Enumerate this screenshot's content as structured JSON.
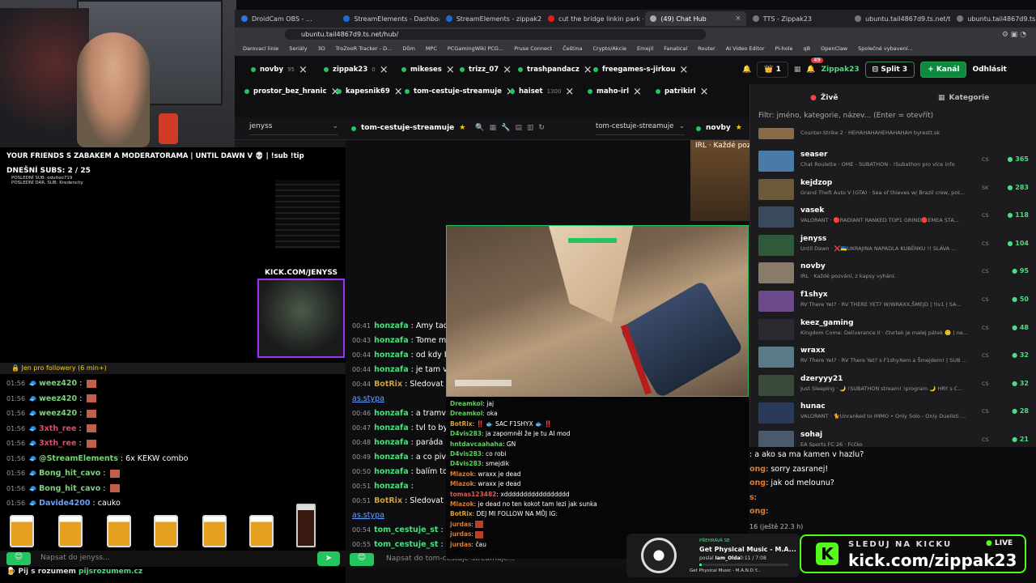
{
  "tabs": [
    {
      "label": "DroidCam OBS - ..."
    },
    {
      "label": "StreamElements - Dashboard"
    },
    {
      "label": "StreamElements - zippak23"
    },
    {
      "label": "cut the bridge linkin park - YouT..."
    },
    {
      "label": "(49) Chat Hub",
      "active": true
    },
    {
      "label": "TTS - Zippak23"
    },
    {
      "label": "ubuntu.tail4867d9.ts.net/tts/api/..."
    },
    {
      "label": "ubuntu.tail4867d9.ts.net/tts/api/..."
    }
  ],
  "address": "ubuntu.tail4867d9.ts.net/hub/",
  "bookmarks": [
    "Darovací linie",
    "Seriály",
    "3D",
    "TroZooR Tracker - D...",
    "Dům",
    "MPC",
    "PCGamingWiki PCG...",
    "Pruse Connect",
    "Čeština",
    "Crypto/Akcie",
    "Ernejil",
    "Fanatical",
    "Router",
    "AI Video Editor",
    "Pi-hole",
    "qB",
    "OpenClaw",
    "Společné vybavení..."
  ],
  "stream_tabs": [
    {
      "name": "novby",
      "count": "95"
    },
    {
      "name": "zippak23",
      "count": "0"
    },
    {
      "name": "mikeses",
      "count": ""
    },
    {
      "name": "trizz_07",
      "count": ""
    },
    {
      "name": "trashpandacz",
      "count": ""
    },
    {
      "name": "freegames-s-jirkou",
      "count": ""
    },
    {
      "name": "prostor_bez_hranic",
      "count": ""
    },
    {
      "name": "kapesnik69",
      "count": ""
    },
    {
      "name": "tom-cestuje-streamuje",
      "count": ""
    },
    {
      "name": "haiset",
      "count": "1300"
    },
    {
      "name": "maho-irl",
      "count": ""
    },
    {
      "name": "patrikirl",
      "count": ""
    }
  ],
  "top": {
    "coins": "1",
    "bell_badge": "49",
    "user": "Zippak23",
    "split": "Split 3",
    "add_channel": "+ Kanál",
    "logout": "Odhlásit"
  },
  "side": {
    "tab_live": "Živě",
    "tab_categories": "Kategorie",
    "filter_placeholder": "Filtr: jméno, kategorie, název... (Enter = otevřít)",
    "first_desc": "Counter-Strike 2 · HEHAHAHAHEHAHAHAH byrestt.sk",
    "channels": [
      {
        "name": "seaser",
        "desc": "Chat Roulette · OME - SUBATHON - !Subathon pro více info",
        "lang": "CS",
        "viewers": "365",
        "color": "#4a7ba8"
      },
      {
        "name": "kejdzop",
        "desc": "Grand Theft Auto V (GTA) · Sea of thieves w/ Brazil crew, pot...",
        "lang": "SK",
        "viewers": "283",
        "color": "#6b5a3a"
      },
      {
        "name": "vasek",
        "desc": "VALORANT · 🔴RADIANT RANKED TOP1 GRIND🔴EMEA STA...",
        "lang": "CS",
        "viewers": "118",
        "color": "#3a4a5c"
      },
      {
        "name": "jenyss",
        "desc": "Until Dawn · ❌🇺🇦UKRAJINA NAPADLA KUBĚNKU !! SLÁVA ...",
        "lang": "CS",
        "viewers": "104",
        "color": "#2e5a3a"
      },
      {
        "name": "novby",
        "desc": "IRL · Každé pozvání, z kapsy vyhání.",
        "lang": "CS",
        "viewers": "95",
        "color": "#8a7a6a"
      },
      {
        "name": "f1shyx",
        "desc": "RV There Yet? · RV THERE YET? W/WRAXX,ŠMEJD | !tv1 | SA...",
        "lang": "CS",
        "viewers": "50",
        "color": "#6a4a8a"
      },
      {
        "name": "keez_gaming",
        "desc": "Kingdom Come: Deliverance II · čtvrtek je malej pátek 🙂 | ne...",
        "lang": "CS",
        "viewers": "48",
        "color": "#2a2a30"
      },
      {
        "name": "wraxx",
        "desc": "RV There Yet? · RV There Yet? s F1shyXem a Šmejdem! | SUB ...",
        "lang": "CS",
        "viewers": "32",
        "color": "#5a7a8a"
      },
      {
        "name": "dzeryyy21",
        "desc": "Just Sleeping · 🌙 !SUBATHON stream! !program 🌙 HRY s C...",
        "lang": "CS",
        "viewers": "32",
        "color": "#3a4a3a"
      },
      {
        "name": "hunac",
        "desc": "VALORANT · 🐈Unranked to IMMO • Only Solo - Only Duelisti ...",
        "lang": "CS",
        "viewers": "28",
        "color": "#2a3a5a"
      },
      {
        "name": "sohaj",
        "desc": "EA Sports FC 26 · Fcčko",
        "lang": "CS",
        "viewers": "21",
        "color": "#4a5a6a"
      }
    ]
  },
  "left": {
    "ticker": "YOUR FRIENDS S ZABAKEM A MODERATORAMA | UNTIL DAWN V 💀 | !sub !tip",
    "subs": "DNEŠNÍ SUBS: 2 / 25",
    "last_sub": "POSLEDNÍ SUB: odviteo719",
    "last_dar": "POSLEDNÍ DAR. SUB: Kredencity",
    "kick_label": "KICK.COM/JENYSS",
    "followers_only": "Jen pro followery (6 min+)",
    "chat": [
      {
        "t": "01:56",
        "user": "weez420",
        "msg": "",
        "color": "#7cd17c"
      },
      {
        "t": "01:56",
        "user": "weez420",
        "msg": "",
        "color": "#7cd17c"
      },
      {
        "t": "01:56",
        "user": "weez420",
        "msg": "",
        "color": "#7cd17c"
      },
      {
        "t": "01:56",
        "user": "3xth_ree",
        "msg": "",
        "color": "#e04a6a"
      },
      {
        "t": "01:56",
        "user": "3xth_ree",
        "msg": "",
        "color": "#e04a6a"
      },
      {
        "t": "01:56",
        "user": "@StreamElements",
        "msg": "6x KEKW combo",
        "color": "#7cd17c"
      },
      {
        "t": "01:56",
        "user": "Bong_hit_cavo",
        "msg": "",
        "color": "#7cd17c"
      },
      {
        "t": "01:56",
        "user": "Bong_hit_cavo",
        "msg": "",
        "color": "#7cd17c"
      },
      {
        "t": "01:56",
        "user": "Davide4200",
        "msg": "cauko",
        "color": "#6aa0ff"
      }
    ],
    "input_placeholder": "Napsat do jenyss...",
    "promo": "Pij s rozumem",
    "promo_link": "pijsrozumem.cz"
  },
  "col1_header": "jenyss",
  "col2_header": "tom-cestuje-streamuje",
  "col2_select": "tom-cestuje-streamuje",
  "col3_header": "novby",
  "col3_title": "IRL · Každé pozi",
  "live_in_col2": "tom-cestuje-streamuje",
  "mid_chat": [
    {
      "t": "00:41",
      "user": "honzafa",
      "msg": "Amy tady"
    },
    {
      "t": "00:43",
      "user": "honzafa",
      "msg": "Tome mus"
    },
    {
      "t": "00:44",
      "user": "honzafa",
      "msg": "od kdy bu"
    },
    {
      "t": "00:44",
      "user": "honzafa",
      "msg": "je tam vůb"
    },
    {
      "t": "00:44",
      "user": "BotRix",
      "msg": "Sledovat"
    },
    {
      "t": "",
      "user": "",
      "msg": "as.stypa"
    },
    {
      "t": "00:46",
      "user": "honzafa",
      "msg": "a tramvaj"
    },
    {
      "t": "00:47",
      "user": "honzafa",
      "msg": "tvl to byc"
    },
    {
      "t": "00:48",
      "user": "honzafa",
      "msg": "paráda"
    },
    {
      "t": "00:49",
      "user": "honzafa",
      "msg": "a co pivo"
    },
    {
      "t": "00:50",
      "user": "honzafa",
      "msg": "balím to n"
    },
    {
      "t": "00:51",
      "user": "honzafa",
      "msg": ""
    },
    {
      "t": "00:51",
      "user": "BotRix",
      "msg": "Sledovat"
    },
    {
      "t": "",
      "user": "",
      "msg": "as.stypa"
    },
    {
      "t": "00:54",
      "user": "tom_cestuje_st",
      "msg": ""
    },
    {
      "t": "00:55",
      "user": "tom_cestuje_st",
      "msg": ""
    }
  ],
  "mid_input": "Napsat do tom-cestuje-streamuje...",
  "overlay_chat": [
    {
      "user": "Dreamkol",
      "msg": "jaj",
      "color": "#5ad15a"
    },
    {
      "user": "Dreamkol",
      "msg": "oka",
      "color": "#5ad15a"
    },
    {
      "user": "BotRix",
      "msg": "‼️ 🐟 SAC F1SHYX 🐟 ‼️",
      "color": "#e0a030"
    },
    {
      "user": "D4vis283",
      "msg": "ja zapomněl že je tu AI mod",
      "color": "#5ad15a"
    },
    {
      "user": "hntdavcaahaha",
      "msg": "GN",
      "color": "#5ad15a"
    },
    {
      "user": "D4vis283",
      "msg": "co robi",
      "color": "#5ad15a"
    },
    {
      "user": "D4vis283",
      "msg": "smejdik",
      "color": "#5ad15a"
    },
    {
      "user": "Mlazok",
      "msg": "wraxx je dead",
      "color": "#e07a2a"
    },
    {
      "user": "Mlazok",
      "msg": "wraxx je dead",
      "color": "#e07a2a"
    },
    {
      "user": "tomas123482",
      "msg": "xddddddddddddddddd",
      "color": "#d85a5a"
    },
    {
      "user": "Mlazok",
      "msg": "je dead no ten kokot tam lezi jak sunka",
      "color": "#e07a2a"
    },
    {
      "user": "BotRix",
      "msg": "DEJ MI FOLLOW NA MŮJ IG:",
      "color": "#e0a030"
    },
    {
      "user": "jurdas",
      "msg": "",
      "color": "#e07a2a"
    },
    {
      "user": "jurdas",
      "msg": "",
      "color": "#e07a2a"
    },
    {
      "user": "jurdas",
      "msg": "čau",
      "color": "#e07a2a"
    }
  ],
  "right_chat": [
    {
      "user": "",
      "msg": "a ako sa ma kamen v hazlu?"
    },
    {
      "user": "ong",
      "msg": "sorry zasranej!"
    },
    {
      "user": "ong",
      "msg": "jak od melounu?"
    },
    {
      "user": "s",
      "msg": ""
    },
    {
      "user": "ong",
      "msg": ""
    }
  ],
  "now_playing": {
    "label": "PŘEHRÁVÁ SE",
    "title": "Get Physical Music - M.A...",
    "by": "poslal",
    "sender": "Iam_Olda",
    "time": "0:11 / 7:08",
    "track": "Get Physical Music - M.A.N.D.Y..."
  },
  "kick_banner": {
    "top": "SLEDUJ NA KICKU",
    "url": "kick.com/zippak23",
    "live": "LIVE",
    "logo": "K"
  },
  "timer": "16 (ještě 22.3 h)"
}
